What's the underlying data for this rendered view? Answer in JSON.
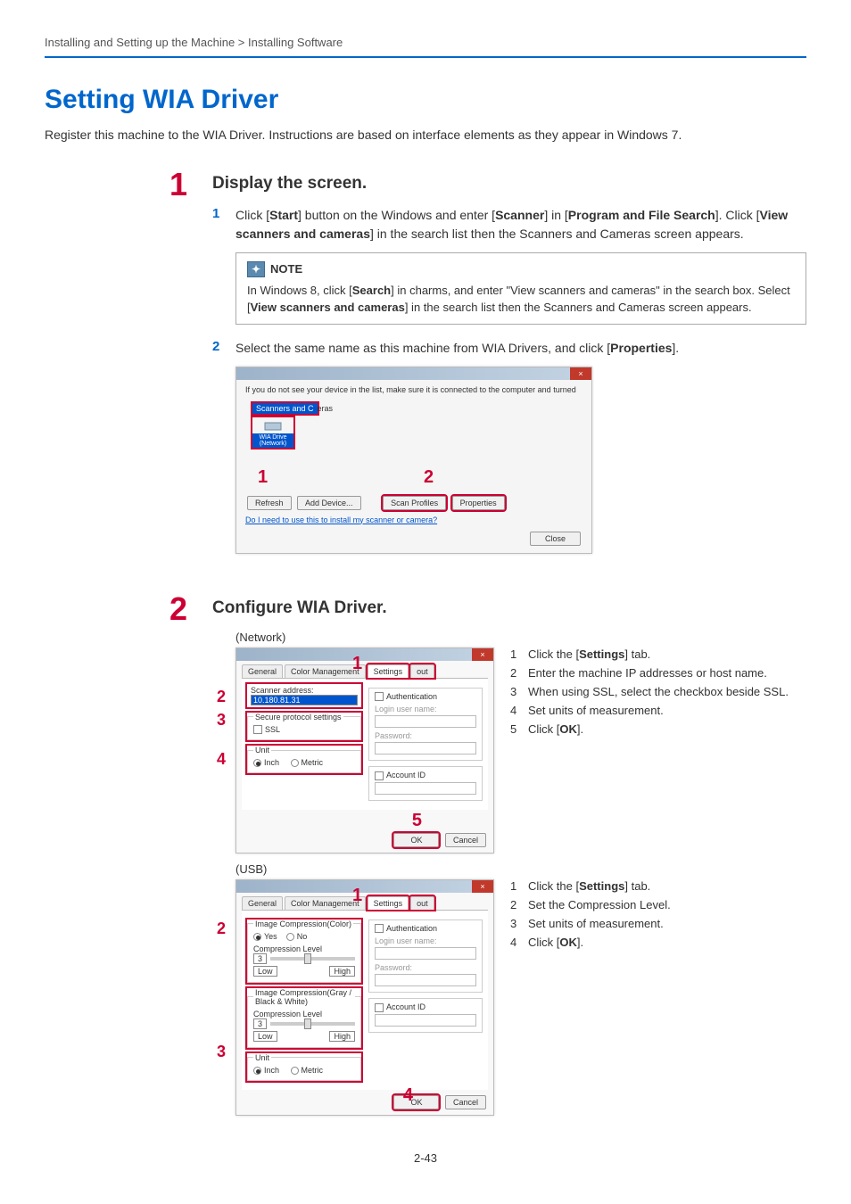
{
  "breadcrumb": "Installing and Setting up the Machine > Installing Software",
  "title": "Setting WIA Driver",
  "intro": "Register this machine to the WIA Driver. Instructions are based on interface elements as they appear in Windows 7.",
  "step1": {
    "num": "1",
    "title": "Display the screen.",
    "sub1": {
      "num": "1",
      "text_parts": {
        "a": "Click [",
        "b": "Start",
        "c": "] button on the Windows and enter [",
        "d": "Scanner",
        "e": "] in [",
        "f": "Program and File Search",
        "g": "]. Click [",
        "h": "View scanners and cameras",
        "i": "] in the search list then the Scanners and Cameras screen appears."
      }
    },
    "note": {
      "label": "NOTE",
      "body_parts": {
        "a": "In Windows 8, click [",
        "b": "Search",
        "c": "] in charms, and enter \"View scanners and cameras\" in the search box. Select [",
        "d": "View scanners and cameras",
        "e": "] in the search list then the Scanners and Cameras screen appears."
      }
    },
    "sub2": {
      "num": "2",
      "text_parts": {
        "a": "Select the same name as this machine from WIA Drivers, and click [",
        "b": "Properties",
        "c": "]."
      }
    },
    "dialog1": {
      "warning": "If you do not see your device in the list, make sure it is connected to the computer and turned",
      "scanners_label": "Scanners and C",
      "scanners_suffix": "eras",
      "wia_label": "WIA Drive",
      "wia_sub": "(Network)",
      "callout1": "1",
      "callout2": "2",
      "btn_refresh": "Refresh",
      "btn_add": "Add Device...",
      "btn_profiles": "Scan Profiles",
      "btn_properties": "Properties",
      "help_link": "Do I need to use this to install my scanner or camera?",
      "btn_close": "Close"
    }
  },
  "step2": {
    "num": "2",
    "title": "Configure WIA Driver.",
    "network_label": "(Network)",
    "usb_label": "(USB)",
    "dialog_net": {
      "tab1": "General",
      "tab2": "Color Management",
      "tab3": "Settings",
      "tab4": "out",
      "callout1": "1",
      "sidebar_2": "2",
      "sidebar_3": "3",
      "sidebar_4": "4",
      "callout5": "5",
      "scanner_addr_label": "Scanner address:",
      "scanner_addr_val": "10.180.81.31",
      "secure_legend": "Secure protocol settings",
      "ssl_label": "SSL",
      "unit_legend": "Unit",
      "inch_label": "Inch",
      "metric_label": "Metric",
      "auth_label": "Authentication",
      "login_label": "Login user name:",
      "password_label": "Password:",
      "account_label": "Account ID",
      "btn_ok": "OK",
      "btn_cancel": "Cancel"
    },
    "dialog_usb": {
      "tab1": "General",
      "tab2": "Color Management",
      "tab3": "Settings",
      "tab4": "out",
      "callout1": "1",
      "sidebar_2": "2",
      "sidebar_3": "3",
      "callout4": "4",
      "color_legend": "Image Compression(Color)",
      "yes_label": "Yes",
      "no_label": "No",
      "comp_label": "Compression Level",
      "comp_val": "3",
      "low_label": "Low",
      "high_label": "High",
      "gray_legend": "Image Compression(Gray / Black & White)",
      "unit_legend": "Unit",
      "inch_label": "Inch",
      "metric_label": "Metric",
      "auth_label": "Authentication",
      "login_label": "Login user name:",
      "password_label": "Password:",
      "account_label": "Account ID",
      "btn_ok": "OK",
      "btn_cancel": "Cancel"
    },
    "net_steps": {
      "s1": {
        "n": "1",
        "t_a": "Click the [",
        "t_b": "Settings",
        "t_c": "] tab."
      },
      "s2": {
        "n": "2",
        "t": "Enter the machine IP addresses or host name."
      },
      "s3": {
        "n": "3",
        "t": "When using SSL, select the checkbox beside SSL."
      },
      "s4": {
        "n": "4",
        "t": "Set units of measurement."
      },
      "s5": {
        "n": "5",
        "t_a": "Click [",
        "t_b": "OK",
        "t_c": "]."
      }
    },
    "usb_steps": {
      "s1": {
        "n": "1",
        "t_a": "Click the [",
        "t_b": "Settings",
        "t_c": "] tab."
      },
      "s2": {
        "n": "2",
        "t": "Set the Compression Level."
      },
      "s3": {
        "n": "3",
        "t": "Set units of measurement."
      },
      "s4": {
        "n": "4",
        "t_a": "Click [",
        "t_b": "OK",
        "t_c": "]."
      }
    }
  },
  "page_num": "2-43"
}
